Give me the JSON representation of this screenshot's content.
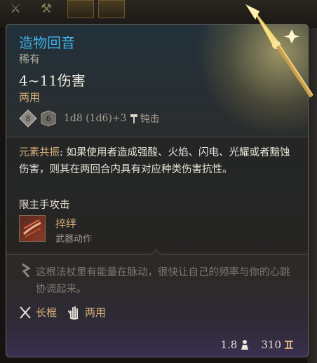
{
  "item": {
    "name": "造物回音",
    "rarity": "稀有",
    "damage": "4~11伤害",
    "handedness": "两用",
    "dice_formula": "1d8 (1d6)+3",
    "damage_type": "钝击",
    "dice_labels": [
      "8",
      "6"
    ]
  },
  "description": {
    "keyword": "元素共振",
    "text": ": 如果使用者造成强酸、火焰、闪电、光耀或者黯蚀伤害，则其在两回合内具有对应种类伤害抗性。"
  },
  "restriction": "限主手攻击",
  "action": {
    "name": "捽绊",
    "type": "武器动作"
  },
  "flavor": "这根法杖里有能量在脉动，很快让自己的频率与你的心跳协调起来。",
  "properties": [
    {
      "label": "长棍",
      "icon": "crossed-staves-icon"
    },
    {
      "label": "两用",
      "icon": "hand-icon"
    }
  ],
  "footer": {
    "weight": "1.8",
    "value": "310"
  },
  "colors": {
    "title": "#3fb2ea",
    "gold": "#d9b07a",
    "text": "#e9e3d8",
    "muted": "#b3aca0"
  }
}
